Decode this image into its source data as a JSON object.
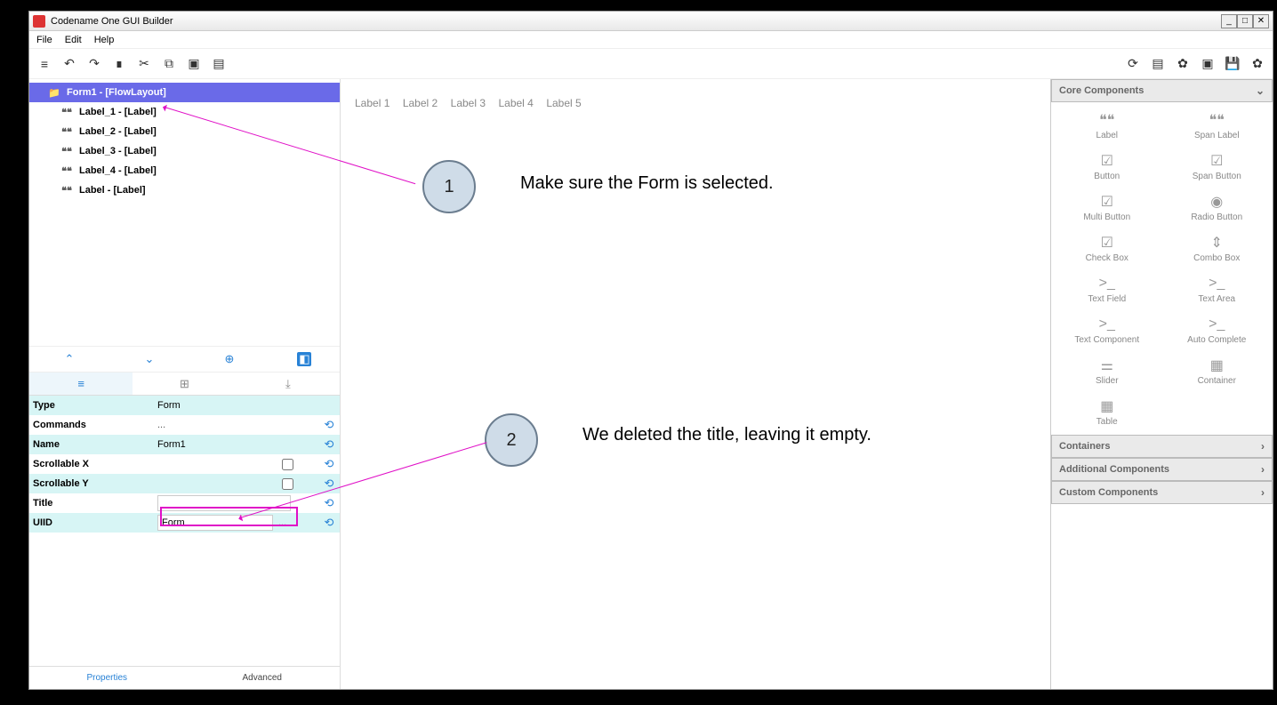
{
  "window": {
    "title": "Codename One GUI Builder"
  },
  "menu": {
    "file": "File",
    "edit": "Edit",
    "help": "Help"
  },
  "toolbar": {
    "left": [
      "menu",
      "undo",
      "redo",
      "delete",
      "cut",
      "copy",
      "paste",
      "new"
    ],
    "right": [
      "refresh",
      "device",
      "settings",
      "image",
      "save",
      "gear"
    ]
  },
  "tree": {
    "root": {
      "label": "Form1 - [FlowLayout]",
      "selected": true
    },
    "children": [
      {
        "label": "Label_1 - [Label]"
      },
      {
        "label": "Label_2 - [Label]"
      },
      {
        "label": "Label_3 - [Label]"
      },
      {
        "label": "Label_4 - [Label]"
      },
      {
        "label": "Label - [Label]"
      }
    ]
  },
  "tree_toolbar": {
    "up": "⌃",
    "down": "⌄",
    "add": "⊕",
    "wrap": "◧"
  },
  "prop_tabs": {
    "basic": "≡",
    "grid": "⊞",
    "layout": "⤓"
  },
  "properties": [
    {
      "name": "Type",
      "value": "Form",
      "kind": "text",
      "revert": false
    },
    {
      "name": "Commands",
      "value": "...",
      "kind": "dots",
      "revert": true
    },
    {
      "name": "Name",
      "value": "Form1",
      "kind": "text",
      "revert": true
    },
    {
      "name": "Scrollable X",
      "value": false,
      "kind": "check",
      "revert": true
    },
    {
      "name": "Scrollable Y",
      "value": false,
      "kind": "check",
      "revert": true
    },
    {
      "name": "Title",
      "value": "",
      "kind": "input",
      "revert": true,
      "highlight": true
    },
    {
      "name": "UIID",
      "value": "Form",
      "kind": "inputdots",
      "revert": true
    }
  ],
  "bottom_tabs": {
    "properties": "Properties",
    "advanced": "Advanced"
  },
  "canvas": {
    "labels": [
      "Label 1",
      "Label 2",
      "Label 3",
      "Label 4",
      "Label 5"
    ]
  },
  "palette": {
    "headers": {
      "core": "Core Components",
      "containers": "Containers",
      "additional": "Additional Components",
      "custom": "Custom Components"
    },
    "core_items": [
      {
        "label": "Label",
        "icon": "❝❝"
      },
      {
        "label": "Span Label",
        "icon": "❝❝"
      },
      {
        "label": "Button",
        "icon": "☑"
      },
      {
        "label": "Span Button",
        "icon": "☑"
      },
      {
        "label": "Multi Button",
        "icon": "☑"
      },
      {
        "label": "Radio Button",
        "icon": "◉"
      },
      {
        "label": "Check Box",
        "icon": "☑"
      },
      {
        "label": "Combo Box",
        "icon": "⇕"
      },
      {
        "label": "Text Field",
        "icon": ">_"
      },
      {
        "label": "Text Area",
        "icon": ">_"
      },
      {
        "label": "Text Component",
        "icon": ">_"
      },
      {
        "label": "Auto Complete",
        "icon": ">_"
      },
      {
        "label": "Slider",
        "icon": "⚌"
      },
      {
        "label": "Container",
        "icon": "▦"
      },
      {
        "label": "Table",
        "icon": "▦"
      }
    ]
  },
  "annotations": {
    "a1": {
      "num": "1",
      "text": "Make sure the Form is selected."
    },
    "a2": {
      "num": "2",
      "text": "We deleted the title, leaving it empty."
    }
  }
}
